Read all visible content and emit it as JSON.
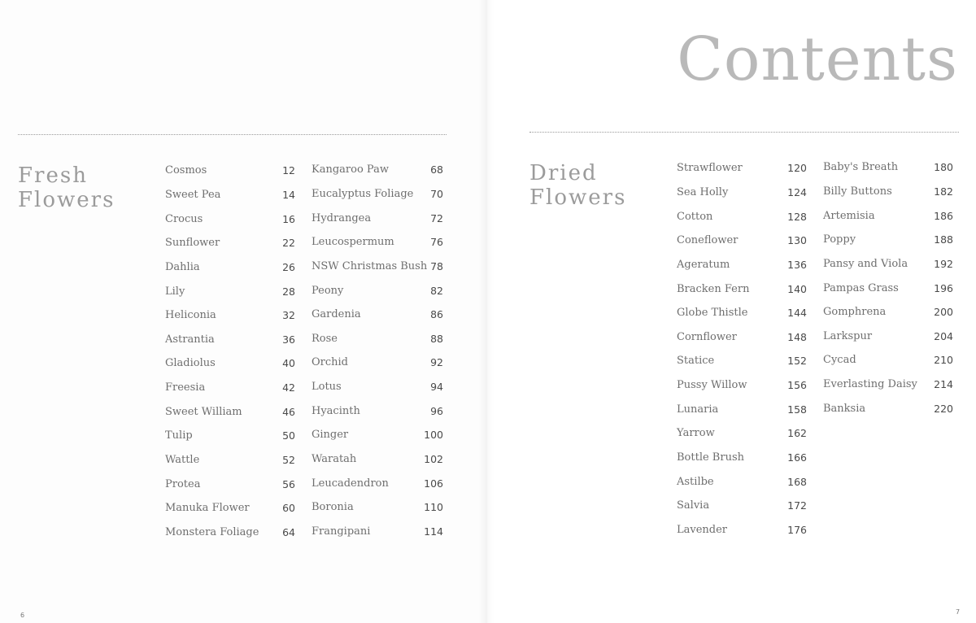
{
  "title": "Contents",
  "fresh": {
    "heading": [
      "Fresh",
      "Flowers"
    ],
    "col1": [
      {
        "name": "Cosmos",
        "page": "12"
      },
      {
        "name": "Sweet Pea",
        "page": "14"
      },
      {
        "name": "Crocus",
        "page": "16"
      },
      {
        "name": "Sunflower",
        "page": "22"
      },
      {
        "name": "Dahlia",
        "page": "26"
      },
      {
        "name": "Lily",
        "page": "28"
      },
      {
        "name": "Heliconia",
        "page": "32"
      },
      {
        "name": "Astrantia",
        "page": "36"
      },
      {
        "name": "Gladiolus",
        "page": "40"
      },
      {
        "name": "Freesia",
        "page": "42"
      },
      {
        "name": "Sweet William",
        "page": "46"
      },
      {
        "name": "Tulip",
        "page": "50"
      },
      {
        "name": "Wattle",
        "page": "52"
      },
      {
        "name": "Protea",
        "page": "56"
      },
      {
        "name": "Manuka Flower",
        "page": "60"
      },
      {
        "name": "Monstera Foliage",
        "page": "64"
      }
    ],
    "col2": [
      {
        "name": "Kangaroo Paw",
        "page": "68"
      },
      {
        "name": "Eucalyptus Foliage",
        "page": "70"
      },
      {
        "name": "Hydrangea",
        "page": "72"
      },
      {
        "name": "Leucospermum",
        "page": "76"
      },
      {
        "name": "NSW Christmas Bush",
        "page": "78"
      },
      {
        "name": "Peony",
        "page": "82"
      },
      {
        "name": "Gardenia",
        "page": "86"
      },
      {
        "name": "Rose",
        "page": "88"
      },
      {
        "name": "Orchid",
        "page": "92"
      },
      {
        "name": "Lotus",
        "page": "94"
      },
      {
        "name": "Hyacinth",
        "page": "96"
      },
      {
        "name": "Ginger",
        "page": "100"
      },
      {
        "name": "Waratah",
        "page": "102"
      },
      {
        "name": "Leucadendron",
        "page": "106"
      },
      {
        "name": "Boronia",
        "page": "110"
      },
      {
        "name": "Frangipani",
        "page": "114"
      }
    ]
  },
  "dried": {
    "heading": [
      "Dried",
      "Flowers"
    ],
    "col1": [
      {
        "name": "Strawflower",
        "page": "120"
      },
      {
        "name": "Sea Holly",
        "page": "124"
      },
      {
        "name": "Cotton",
        "page": "128"
      },
      {
        "name": "Coneflower",
        "page": "130"
      },
      {
        "name": "Ageratum",
        "page": "136"
      },
      {
        "name": "Bracken Fern",
        "page": "140"
      },
      {
        "name": "Globe Thistle",
        "page": "144"
      },
      {
        "name": "Cornflower",
        "page": "148"
      },
      {
        "name": "Statice",
        "page": "152"
      },
      {
        "name": "Pussy Willow",
        "page": "156"
      },
      {
        "name": "Lunaria",
        "page": "158"
      },
      {
        "name": "Yarrow",
        "page": "162"
      },
      {
        "name": "Bottle Brush",
        "page": "166"
      },
      {
        "name": "Astilbe",
        "page": "168"
      },
      {
        "name": "Salvia",
        "page": "172"
      },
      {
        "name": "Lavender",
        "page": "176"
      }
    ],
    "col2": [
      {
        "name": "Baby's Breath",
        "page": "180"
      },
      {
        "name": "Billy Buttons",
        "page": "182"
      },
      {
        "name": "Artemisia",
        "page": "186"
      },
      {
        "name": "Poppy",
        "page": "188"
      },
      {
        "name": "Pansy and Viola",
        "page": "192"
      },
      {
        "name": "Pampas Grass",
        "page": "196"
      },
      {
        "name": "Gomphrena",
        "page": "200"
      },
      {
        "name": "Larkspur",
        "page": "204"
      },
      {
        "name": "Cycad",
        "page": "210"
      },
      {
        "name": "Everlasting Daisy",
        "page": "214"
      },
      {
        "name": "Banksia",
        "page": "220"
      }
    ]
  },
  "folio": {
    "left": "6",
    "right": "7"
  },
  "colors": {
    "title": "#b9b9b9",
    "heading": "#9b9b9b",
    "text": "#6e6e6e",
    "page_number": "#4a4a4a"
  }
}
